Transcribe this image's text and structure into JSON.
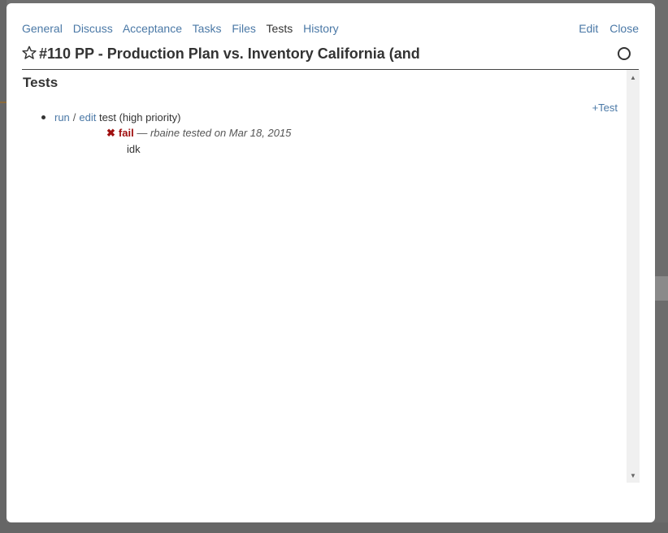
{
  "tabs": [
    "General",
    "Discuss",
    "Acceptance",
    "Tasks",
    "Files",
    "Tests",
    "History"
  ],
  "active_tab": "Tests",
  "actions": {
    "edit": "Edit",
    "close": "Close"
  },
  "ticket": {
    "title": "#110 PP - Production Plan vs. Inventory California (and"
  },
  "section": {
    "title": "Tests",
    "add_label": "+Test"
  },
  "test": {
    "run_label": "run",
    "sep": "/",
    "edit_label": "edit",
    "name": "test (high priority)",
    "result": {
      "icon": "x-icon",
      "status": "fail",
      "dash": "—",
      "meta": "rbaine tested on Mar 18, 2015",
      "note": "idk"
    }
  },
  "colors": {
    "link": "#4a78a6",
    "fail": "#a01010",
    "overlay": "#6f6f6f"
  }
}
